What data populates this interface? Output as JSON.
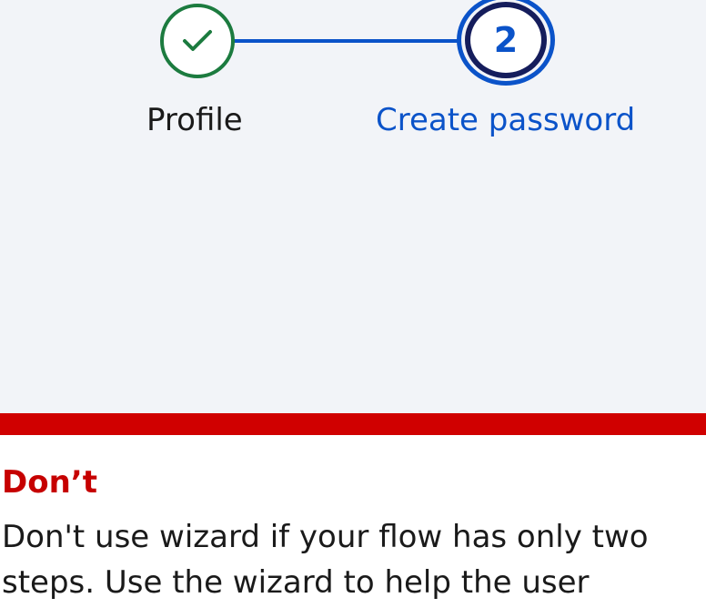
{
  "wizard": {
    "steps": [
      {
        "label": "Profile",
        "state": "completed",
        "icon": "checkmark-icon"
      },
      {
        "label": "Create password",
        "number": "2",
        "state": "current"
      }
    ]
  },
  "guideline": {
    "heading": "Don’t",
    "body": "Don't use wizard if your flow has only two steps. Use the wizard to help the user"
  },
  "colors": {
    "preview_background": "#f2f4f8",
    "completed": "#1c7b3f",
    "active": "#0b53c9",
    "active_inner_ring": "#151d5c",
    "dont_red": "#d00000",
    "dont_heading": "#c60000"
  }
}
